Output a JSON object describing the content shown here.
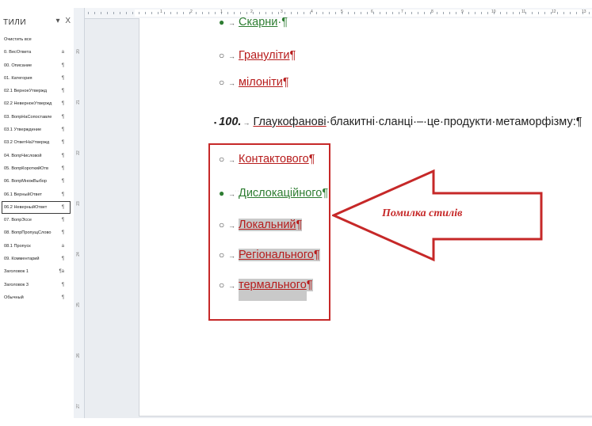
{
  "styles_pane": {
    "title": "ТИЛИ",
    "controls": {
      "dropdown": "▾",
      "close": "X"
    },
    "items": [
      {
        "label": "Очистить все",
        "mark": ""
      },
      {
        "label": "0. ВесОтвета",
        "mark": "a"
      },
      {
        "label": "00. Описание",
        "mark": "¶"
      },
      {
        "label": "01. Категория",
        "mark": "¶"
      },
      {
        "label": "02.1 ВерноеУтвержд",
        "mark": "¶"
      },
      {
        "label": "02.2 НеверноеУтвержд",
        "mark": "¶"
      },
      {
        "label": "03. ВопрНаСопоставле",
        "mark": "¶"
      },
      {
        "label": "03.1 Утверждение",
        "mark": "¶"
      },
      {
        "label": "03.2 ОтветНаУтвержд",
        "mark": "¶"
      },
      {
        "label": "04. ВопрЧисловой",
        "mark": "¶"
      },
      {
        "label": "05. ВопрКороткийОтв",
        "mark": "¶"
      },
      {
        "label": "06. ВопрМножВыбор",
        "mark": "¶"
      },
      {
        "label": "06.1 ВерныйОтвет",
        "mark": "¶"
      },
      {
        "label": "06.2 НеверныйОтвет",
        "mark": "¶"
      },
      {
        "label": "07. ВопрЭссе",
        "mark": "¶"
      },
      {
        "label": "08. ВопрПропущСлово",
        "mark": "¶"
      },
      {
        "label": "08.1 Пропуск",
        "mark": "a"
      },
      {
        "label": "09. Комментарий",
        "mark": "¶"
      },
      {
        "label": "Заголовок 1",
        "mark": "¶a"
      },
      {
        "label": "Заголовок 3",
        "mark": "¶"
      },
      {
        "label": "Обычный",
        "mark": "¶"
      }
    ],
    "selected_index": 13
  },
  "ruler": {
    "h_numbers": [
      "1",
      "2",
      "1",
      "2",
      "3",
      "4",
      "5",
      "6",
      "7",
      "8",
      "9",
      "10",
      "11",
      "12",
      "13"
    ],
    "v_numbers": [
      "20",
      "21",
      "22",
      "23",
      "24",
      "25",
      "26",
      "27"
    ]
  },
  "document": {
    "top_options": [
      {
        "bullet": "●",
        "filled": true,
        "text": "Скарни",
        "tail": "·¶",
        "style": "green"
      },
      {
        "bullet": "○",
        "filled": false,
        "text": "Гранулiти",
        "tail": "¶",
        "style": "red"
      },
      {
        "bullet": "○",
        "filled": false,
        "text": "мiлонiти",
        "tail": "¶",
        "style": "red"
      }
    ],
    "question": {
      "bullet": "▪",
      "number": "100.",
      "arrow": "→",
      "underlined_word": "Глаукофановi",
      "rest": "·блакитнi·сланцi·–·це·продукти·метаморфiзму:¶"
    },
    "answer_options": [
      {
        "bullet": "○",
        "filled": false,
        "text": "Контактового",
        "tail": "¶",
        "style": "red",
        "shaded": false
      },
      {
        "bullet": "●",
        "filled": true,
        "text": "Дислокацiйного",
        "tail": "¶",
        "style": "green",
        "shaded": false
      },
      {
        "bullet": "○",
        "filled": false,
        "text": "Локальний",
        "tail": "¶",
        "style": "red",
        "shaded": true
      },
      {
        "bullet": "○",
        "filled": false,
        "text": "Регiонального",
        "tail": "¶",
        "style": "red",
        "shaded": true
      },
      {
        "bullet": "○",
        "filled": false,
        "text": "термального",
        "tail": "¶",
        "style": "red",
        "shaded": true
      }
    ],
    "tab_arrow": "→"
  },
  "callout": {
    "label": "Помилка стилiв"
  },
  "colors": {
    "error_red": "#c62828",
    "correct_green": "#2e7d32",
    "shade_gray": "#c9c9c9"
  }
}
